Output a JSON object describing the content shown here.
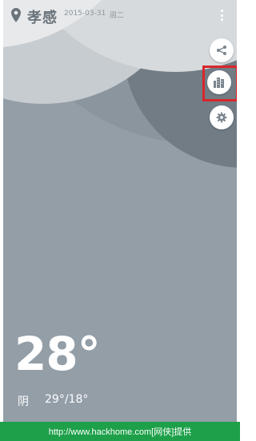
{
  "header": {
    "city": "孝感",
    "date": "2015-03-31",
    "weekday": "周二"
  },
  "icons": {
    "location": "location-pin-icon",
    "more": "more-vert-icon",
    "share": "share-icon",
    "city_list": "city-buildings-icon",
    "settings": "gear-icon"
  },
  "weather": {
    "current_temp": "28°",
    "condition": "阴",
    "range": "29°/18°"
  },
  "footer": {
    "watermark": "http://www.hackhome.com[网侠]提供"
  },
  "colors": {
    "background": "#939ea7",
    "highlight": "#d9262b",
    "footer": "#1da049"
  }
}
